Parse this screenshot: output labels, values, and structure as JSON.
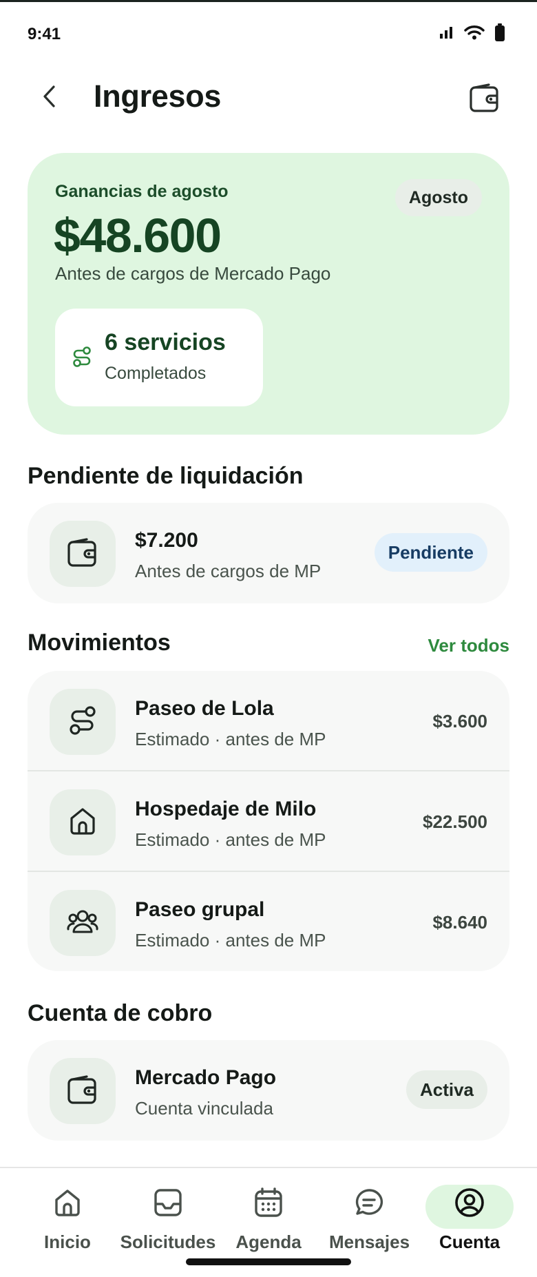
{
  "status_bar": {
    "time": "9:41"
  },
  "header": {
    "title": "Ingresos"
  },
  "summary": {
    "label": "Ganancias de agosto",
    "amount": "$48.600",
    "note": "Antes de cargos de Mercado Pago",
    "month_chip": "Agosto",
    "services_count": "6 servicios",
    "services_label": "Completados"
  },
  "pending": {
    "section_title": "Pendiente de liquidación",
    "amount": "$7.200",
    "note": "Antes de cargos de MP",
    "badge": "Pendiente"
  },
  "movements": {
    "section_title": "Movimientos",
    "see_all": "Ver todos",
    "items": [
      {
        "title": "Paseo de Lola",
        "sub": "Estimado · antes de MP",
        "amount": "$3.600",
        "icon": "route-icon"
      },
      {
        "title": "Hospedaje de Milo",
        "sub": "Estimado · antes de MP",
        "amount": "$22.500",
        "icon": "house-icon"
      },
      {
        "title": "Paseo grupal",
        "sub": "Estimado · antes de MP",
        "amount": "$8.640",
        "icon": "group-icon"
      }
    ]
  },
  "payout_account": {
    "section_title": "Cuenta de cobro",
    "name": "Mercado Pago",
    "sub": "Cuenta vinculada",
    "badge": "Activa"
  },
  "nav": {
    "items": [
      {
        "label": "Inicio",
        "icon": "home-icon"
      },
      {
        "label": "Solicitudes",
        "icon": "inbox-icon"
      },
      {
        "label": "Agenda",
        "icon": "calendar-icon"
      },
      {
        "label": "Mensajes",
        "icon": "chat-icon"
      },
      {
        "label": "Cuenta",
        "icon": "account-icon",
        "active": true
      }
    ]
  },
  "colors": {
    "accent_green": "#2e8a3e",
    "summary_bg": "#dff6e0",
    "amount_green": "#164423",
    "pending_badge_bg": "#e2f0fb"
  }
}
